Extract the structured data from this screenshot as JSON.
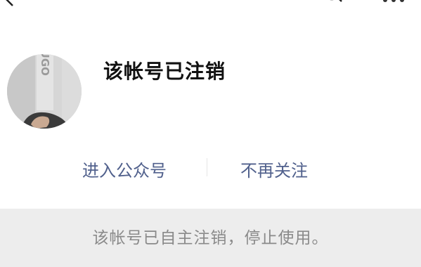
{
  "top_bar": {
    "back_icon": "chevron-left-icon",
    "search_icon": "search-icon",
    "more_icon": "more-dots-icon"
  },
  "profile": {
    "avatar_text": "HUGO",
    "name": "该帐号已注销"
  },
  "actions": {
    "enter_label": "进入公众号",
    "unfollow_label": "不再关注"
  },
  "notice": {
    "text": "该帐号已自主注销，停止使用。"
  },
  "colors": {
    "link": "#50608c",
    "notice_bg": "#ededed",
    "notice_text": "#8a8a8a"
  }
}
